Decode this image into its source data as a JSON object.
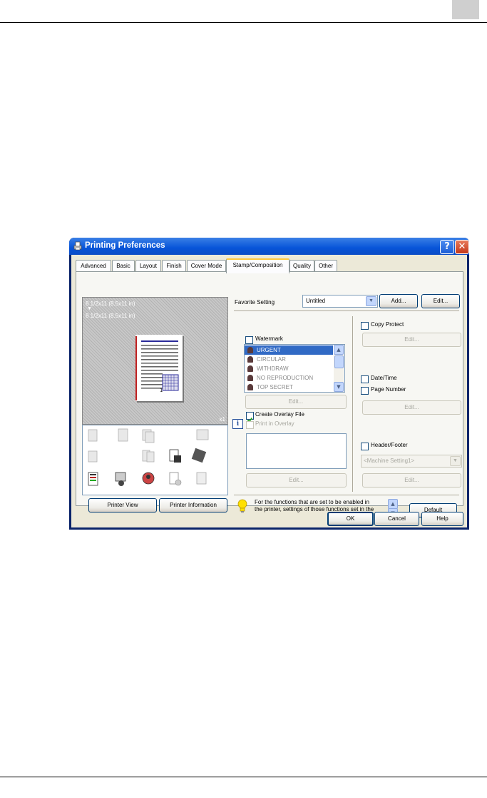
{
  "window": {
    "title": "Printing Preferences",
    "help_glyph": "?",
    "close_glyph": "✕"
  },
  "tabs": [
    "Advanced",
    "Basic",
    "Layout",
    "Finish",
    "Cover Mode",
    "Stamp/Composition",
    "Quality",
    "Other"
  ],
  "active_tab": "Stamp/Composition",
  "preview": {
    "line1": "8 1/2x11 (8.5x11 in)",
    "arrow": "▼",
    "line2": "8 1/2x11 (8.5x11 in)",
    "copies": "x1"
  },
  "left_buttons": {
    "printer_view": "Printer View",
    "printer_information": "Printer Information"
  },
  "favorite": {
    "label": "Favorite Setting",
    "value": "Untitled",
    "add": "Add...",
    "edit": "Edit..."
  },
  "watermark": {
    "label": "Watermark",
    "checked": false,
    "items": [
      "URGENT",
      "CIRCULAR",
      "WITHDRAW",
      "NO REPRODUCTION",
      "TOP SECRET"
    ],
    "selected": "URGENT",
    "edit": "Edit..."
  },
  "overlay": {
    "create_label": "Create Overlay File",
    "create_checked": true,
    "print_label": "Print in Overlay",
    "print_checked": false,
    "edit": "Edit..."
  },
  "copy_protect": {
    "label": "Copy Protect",
    "checked": false,
    "edit": "Edit..."
  },
  "date_time": {
    "label": "Date/Time",
    "checked": false
  },
  "page_number": {
    "label": "Page Number",
    "checked": false,
    "edit": "Edit..."
  },
  "header_footer": {
    "label": "Header/Footer",
    "checked": false,
    "select_value": "<Machine Setting1>",
    "edit": "Edit..."
  },
  "info": {
    "line1": "For the functions that are set to be enabled in",
    "line2": "the printer, settings of those functions set in the",
    "default": "Default"
  },
  "footer_buttons": {
    "ok": "OK",
    "cancel": "Cancel",
    "help": "Help"
  },
  "colors": {
    "titlebar": "#0754d8",
    "dialog_bg": "#ece9d8",
    "selected_item": "#316ac5",
    "check_green": "#21a121"
  }
}
